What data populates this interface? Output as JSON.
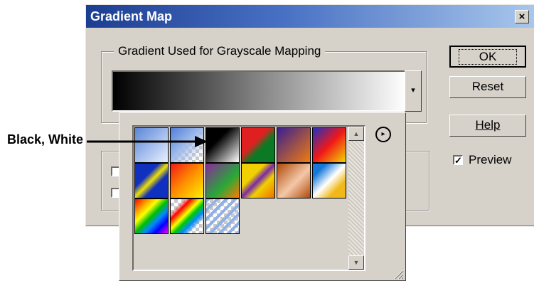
{
  "dialog": {
    "title": "Gradient Map",
    "close_label": "×",
    "group_label": "Gradient Used for Grayscale Mapping",
    "ok_label": "OK",
    "reset_label": "Reset",
    "help_label": "Help",
    "preview_label": "Preview",
    "preview_checked": true,
    "preview_check_glyph": "✓"
  },
  "gradient_picker": {
    "dropdown_glyph": "▾",
    "menu_glyph": "▸",
    "scroll_up_glyph": "▲",
    "scroll_down_glyph": "▼",
    "swatches": [
      {
        "name": "gradient-swatch-1",
        "bg": "linear-gradient(135deg,#5a86d8,#e8f0ff)"
      },
      {
        "name": "gradient-swatch-2",
        "bg": "linear-gradient(135deg,#4f7fd6 0%,#9db9ea 45%,transparent 85%),repeating-conic-gradient(#c9c9c9 0% 25%,#ffffff 0% 50%) 0 0/10px 10px"
      },
      {
        "name": "gradient-swatch-black-white",
        "bg": "linear-gradient(135deg,#000 35%,#fff 100%)"
      },
      {
        "name": "gradient-swatch-4",
        "bg": "linear-gradient(135deg,#e02020 40%,#0c7a24 60%)"
      },
      {
        "name": "gradient-swatch-5",
        "bg": "linear-gradient(135deg,#3a1f8f,#f07c10)"
      },
      {
        "name": "gradient-swatch-6",
        "bg": "linear-gradient(135deg,#2030c0 0%,#f01818 50%,#f0d800 100%)"
      },
      {
        "name": "gradient-swatch-7",
        "bg": "linear-gradient(135deg,#1030c0 35%,#f0e000 50%,#1030c0 65%)"
      },
      {
        "name": "gradient-swatch-8",
        "bg": "linear-gradient(135deg,#f01818,#ff9000 50%,#fff200)"
      },
      {
        "name": "gradient-swatch-9",
        "bg": "linear-gradient(135deg,#8a2a9a,#28a838 60%,#ff7a00)"
      },
      {
        "name": "gradient-swatch-10",
        "bg": "linear-gradient(135deg,#f0d000 35%,#7a2aa8 50%,#f0d000 65%,#f07000)"
      },
      {
        "name": "gradient-swatch-11",
        "bg": "linear-gradient(135deg,#b04808,#f4c8a8 55%,#b04808)"
      },
      {
        "name": "gradient-swatch-12",
        "bg": "linear-gradient(135deg,#1878d8 20%,#ffffff 50%,#f0b818 75%)"
      },
      {
        "name": "gradient-swatch-13",
        "bg": "linear-gradient(135deg,#ff0000,#ff9900 20%,#ffff00 35%,#00c000 50%,#0088ff 65%,#0000ff 80%,#ff00ff)"
      },
      {
        "name": "gradient-swatch-14",
        "bg": "linear-gradient(135deg,transparent 20%,#ff0000 30%,#ffff00 45%,#00cc00 55%,#0088ff 68%,transparent 80%),repeating-conic-gradient(#c9c9c9 0% 25%,#ffffff 0% 50%) 0 0/10px 10px"
      },
      {
        "name": "gradient-swatch-15",
        "bg": "repeating-linear-gradient(135deg,#8fb0e8 0 4px,transparent 4px 9px),repeating-conic-gradient(#c9c9c9 0% 25%,#ffffff 0% 50%) 0 0/10px 10px"
      }
    ]
  },
  "annotation": {
    "label": "Black, White"
  },
  "colors": {
    "title_start": "#1c3e92",
    "title_end": "#a9c7ec",
    "dialog_face": "#d6d2ca"
  }
}
